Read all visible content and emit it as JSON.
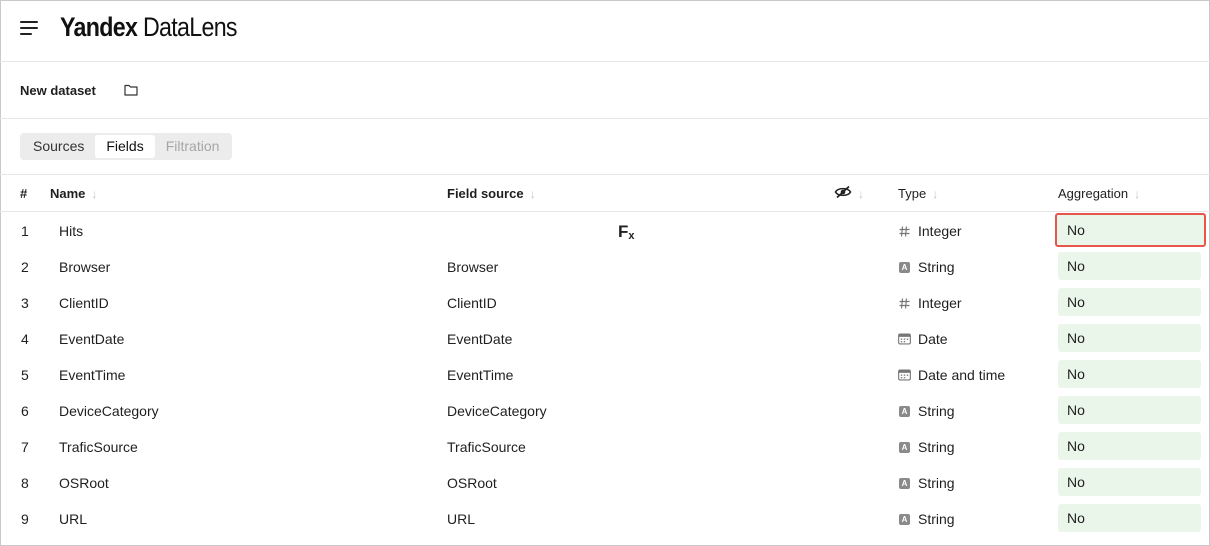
{
  "app": {
    "logo_bold": "Yandex",
    "logo_light": "DataLens",
    "menu_icon": "hamburger-icon"
  },
  "dataset": {
    "title": "New dataset",
    "folder_icon": "folder-icon"
  },
  "tabs": [
    {
      "label": "Sources",
      "state": "normal"
    },
    {
      "label": "Fields",
      "state": "active"
    },
    {
      "label": "Filtration",
      "state": "disabled"
    }
  ],
  "table": {
    "headers": {
      "number": "#",
      "name": "Name",
      "field_source": "Field source",
      "visibility_icon": "eye-crossed-icon",
      "type": "Type",
      "aggregation": "Aggregation"
    },
    "sort_icon": "arrow-down-icon",
    "formula_label": "F",
    "formula_sub": "x",
    "rows": [
      {
        "num": "1",
        "name": "Hits",
        "source": "",
        "formula": true,
        "type": "Integer",
        "type_icon": "hash-icon",
        "aggregation": "No"
      },
      {
        "num": "2",
        "name": "Browser",
        "source": "Browser",
        "formula": false,
        "type": "String",
        "type_icon": "string-icon",
        "aggregation": "No"
      },
      {
        "num": "3",
        "name": "ClientID",
        "source": "ClientID",
        "formula": false,
        "type": "Integer",
        "type_icon": "hash-icon",
        "aggregation": "No"
      },
      {
        "num": "4",
        "name": "EventDate",
        "source": "EventDate",
        "formula": false,
        "type": "Date",
        "type_icon": "calendar-icon",
        "aggregation": "No"
      },
      {
        "num": "5",
        "name": "EventTime",
        "source": "EventTime",
        "formula": false,
        "type": "Date and time",
        "type_icon": "calendar-icon",
        "aggregation": "No"
      },
      {
        "num": "6",
        "name": "DeviceCategory",
        "source": "DeviceCategory",
        "formula": false,
        "type": "String",
        "type_icon": "string-icon",
        "aggregation": "No"
      },
      {
        "num": "7",
        "name": "TraficSource",
        "source": "TraficSource",
        "formula": false,
        "type": "String",
        "type_icon": "string-icon",
        "aggregation": "No"
      },
      {
        "num": "8",
        "name": "OSRoot",
        "source": "OSRoot",
        "formula": false,
        "type": "String",
        "type_icon": "string-icon",
        "aggregation": "No"
      },
      {
        "num": "9",
        "name": "URL",
        "source": "URL",
        "formula": false,
        "type": "String",
        "type_icon": "string-icon",
        "aggregation": "No"
      }
    ]
  },
  "colors": {
    "aggregation_bg": "#e9f6e9",
    "highlight_border": "#e8554a",
    "divider": "#e6e6e6"
  }
}
